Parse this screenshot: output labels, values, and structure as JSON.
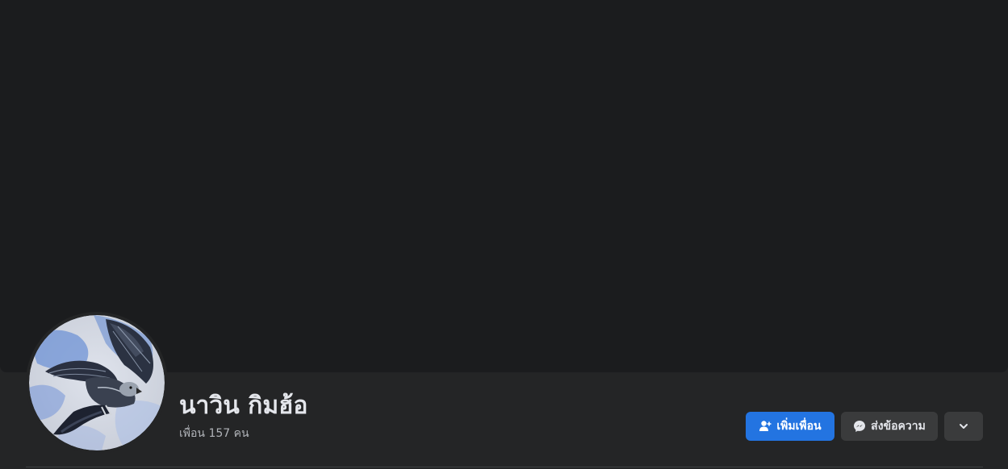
{
  "profile": {
    "name": "นาวิน กิมฮ้อ",
    "friends_count": "เพื่อน 157 คน"
  },
  "actions": {
    "add_friend_label": "เพิ่มเพื่อน",
    "message_label": "ส่งข้อความ"
  },
  "icons": {
    "add_friend": "add-friend-icon",
    "message": "messenger-icon",
    "more": "chevron-down-icon",
    "avatar": "eagle-painting-avatar"
  },
  "colors": {
    "page_background": "#242526",
    "cover_background": "#1b1c1e",
    "primary_button": "#2374e1",
    "secondary_button": "#3a3b3c",
    "primary_text": "#e4e6eb",
    "secondary_text": "#b0b3b8"
  }
}
